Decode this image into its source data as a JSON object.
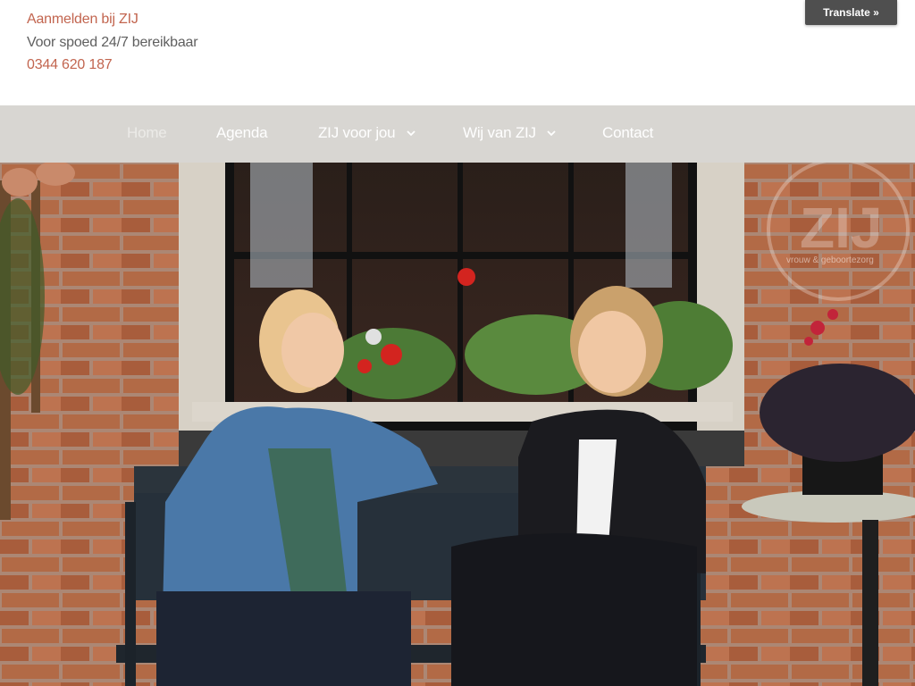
{
  "header": {
    "login_link": "Aanmelden bij ZIJ",
    "tagline": "Voor spoed 24/7 bereikbaar",
    "phone": "0344 620 187"
  },
  "translate": {
    "label": "Translate »"
  },
  "nav": {
    "items": [
      {
        "label": "Home",
        "active": true,
        "has_dropdown": false
      },
      {
        "label": "Agenda",
        "active": false,
        "has_dropdown": false
      },
      {
        "label": "ZIJ voor jou",
        "active": false,
        "has_dropdown": true
      },
      {
        "label": "Wij van ZIJ",
        "active": false,
        "has_dropdown": true
      },
      {
        "label": "Contact",
        "active": false,
        "has_dropdown": false
      }
    ]
  },
  "hero": {
    "watermark_logo": "ZIJ",
    "watermark_sub": "vrouw & geboortezorg"
  },
  "colors": {
    "accent": "#c2654f",
    "text_muted": "#5f5f5f",
    "nav_bg": "#d8d6d2",
    "translate_bg": "#4f4f4f"
  }
}
